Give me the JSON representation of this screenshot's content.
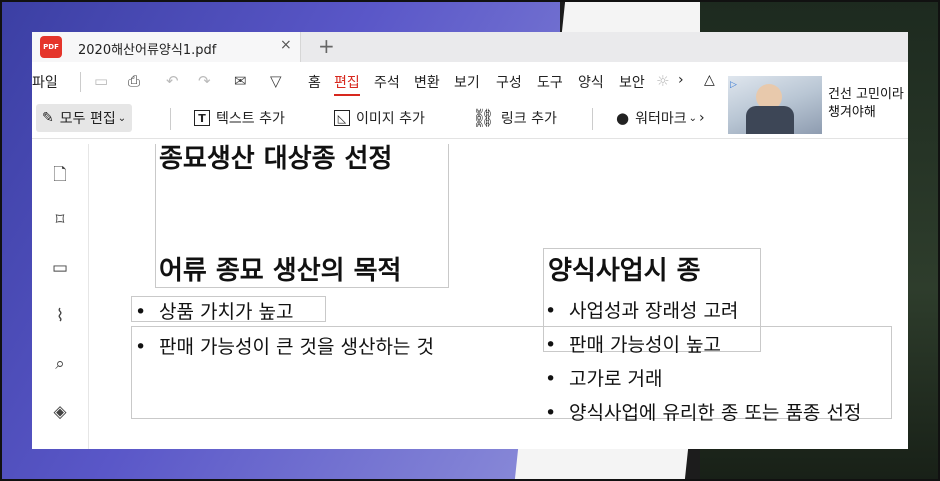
{
  "tab": {
    "logo_text": "PDF",
    "title": "2020해산어류양식1.pdf",
    "close": "×",
    "new_tab": "+"
  },
  "menu": {
    "file": "파일",
    "items": [
      "홈",
      "편집",
      "주석",
      "변환",
      "보기",
      "구성",
      "도구",
      "양식",
      "보안"
    ],
    "active": "편집",
    "more": "›",
    "collapse": "△"
  },
  "tools": {
    "edit_all": "모두 편집",
    "add_text": "텍스트 추가",
    "add_image": "이미지 추가",
    "add_link": "링크 추가",
    "watermark": "워터마크",
    "caret": "⌄"
  },
  "ad": {
    "line1": "건선 고민이라",
    "line2": "챙겨야해"
  },
  "document": {
    "top_heading": "종묘생산 대상종 선정",
    "heading_left": "어류 종묘 생산의 목적",
    "heading_right": "양식사업시 종",
    "bullets_left": [
      "상품 가치가 높고",
      "판매 가능성이 큰 것을 생산하는 것"
    ],
    "bullets_right": [
      "사업성과 장래성 고려",
      "판매 가능성이 높고",
      "고가로 거래",
      "양식사업에 유리한 종 또는 품종 선정"
    ],
    "bullet_char": "•"
  }
}
